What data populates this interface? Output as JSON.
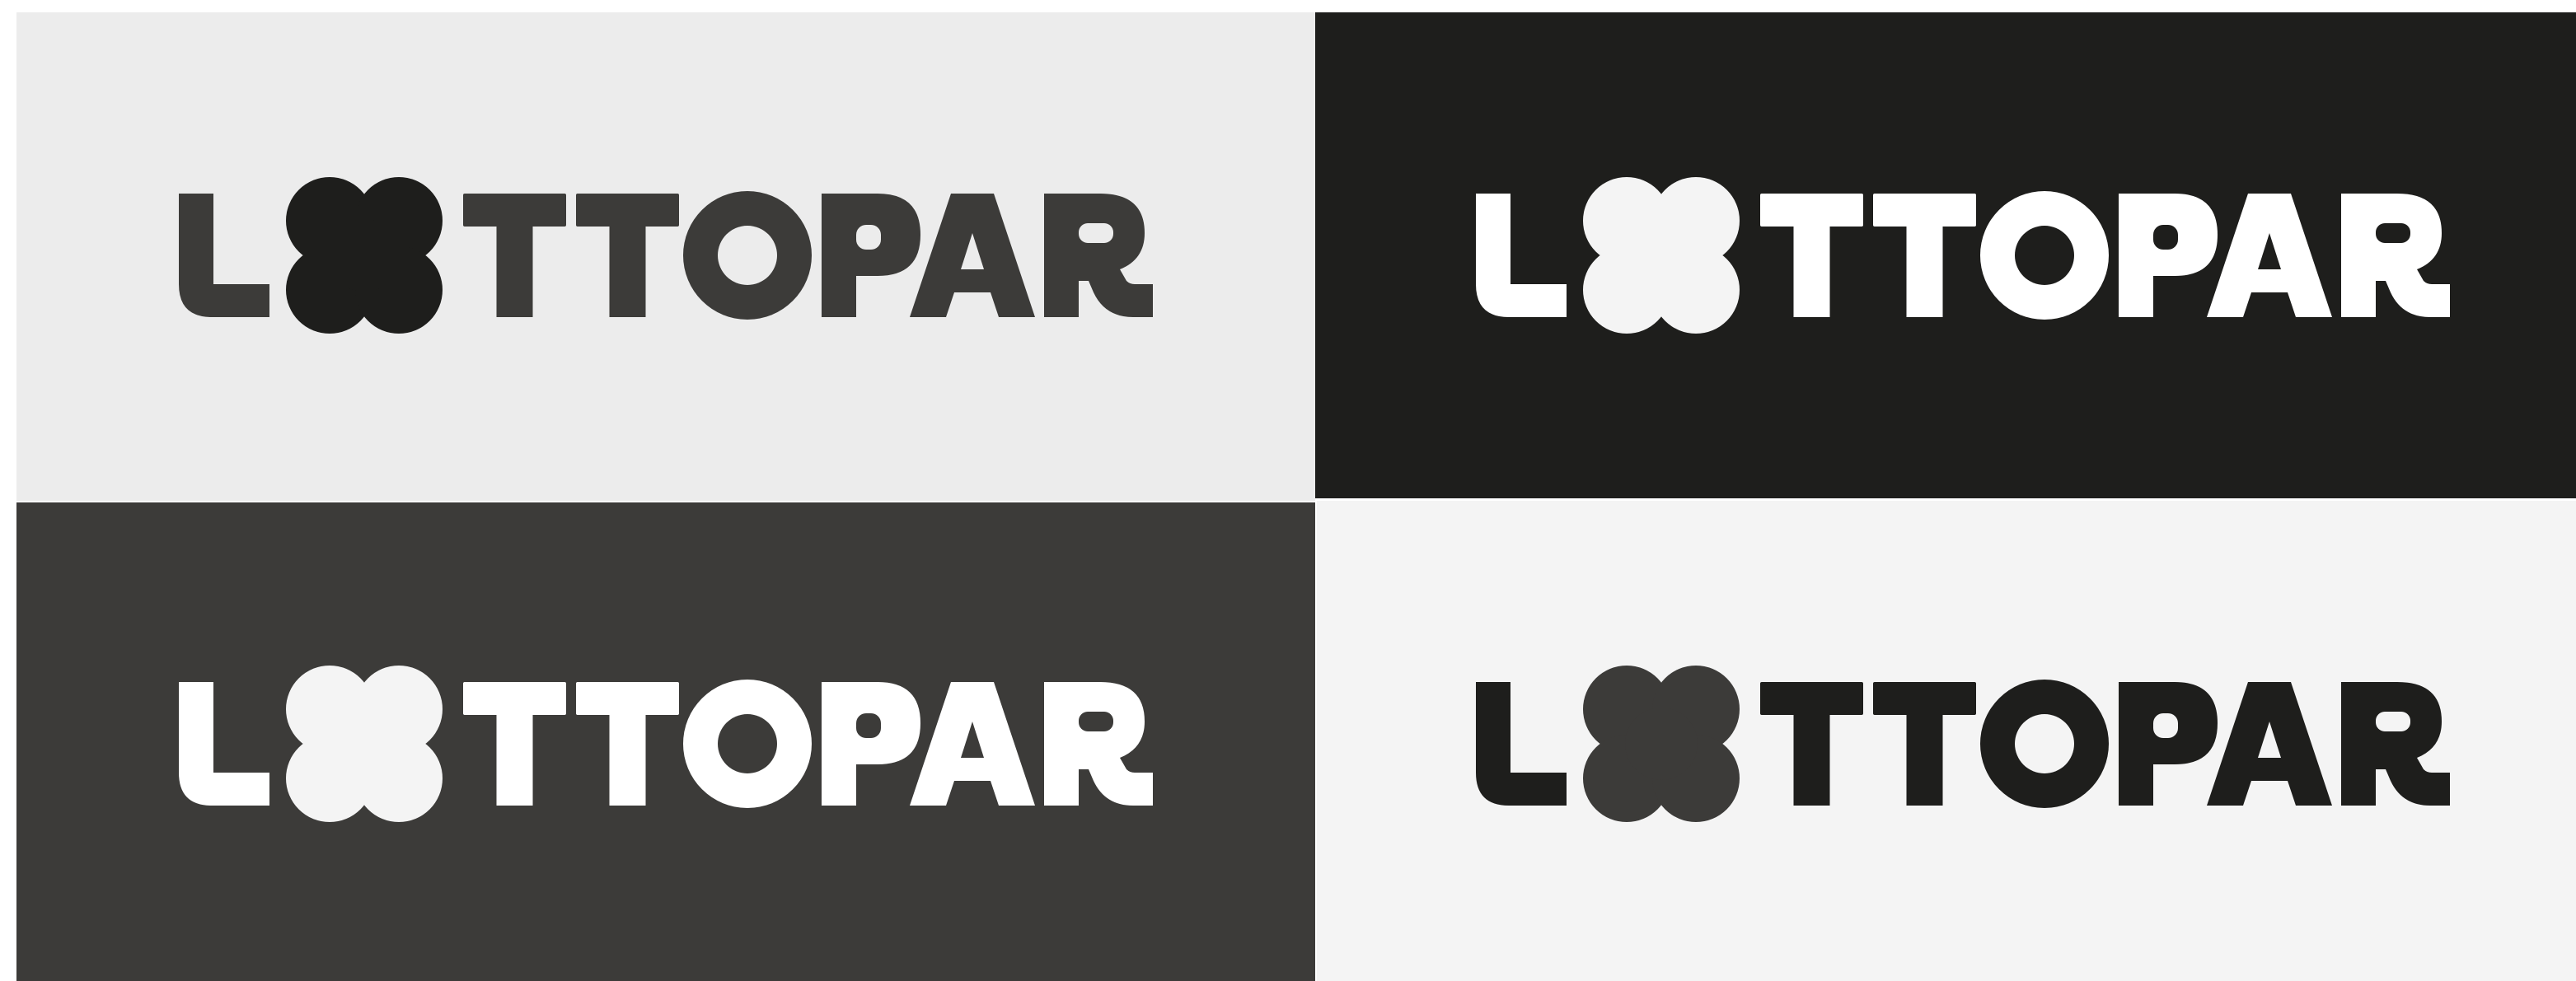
{
  "logo": {
    "wordmark": "LOTTOPAR",
    "letters": [
      "L",
      "T",
      "T",
      "O",
      "P",
      "A",
      "R"
    ],
    "mark_icon": "clover-icon"
  },
  "panels": [
    {
      "id": "light-gray",
      "background": "#ececec",
      "letter_color": "#3c3b39",
      "clover_color": "#1e1e1c",
      "counter_color": "#ececec"
    },
    {
      "id": "black",
      "background": "#1e1e1c",
      "letter_color": "#ffffff",
      "clover_color": "#f4f4f4",
      "counter_color": "#1e1e1c"
    },
    {
      "id": "dark-gray",
      "background": "#3c3b39",
      "letter_color": "#ffffff",
      "clover_color": "#f4f4f4",
      "counter_color": "#3c3b39"
    },
    {
      "id": "off-white",
      "background": "#f4f4f4",
      "letter_color": "#1e1e1c",
      "clover_color": "#3c3b39",
      "counter_color": "#f4f4f4"
    }
  ]
}
